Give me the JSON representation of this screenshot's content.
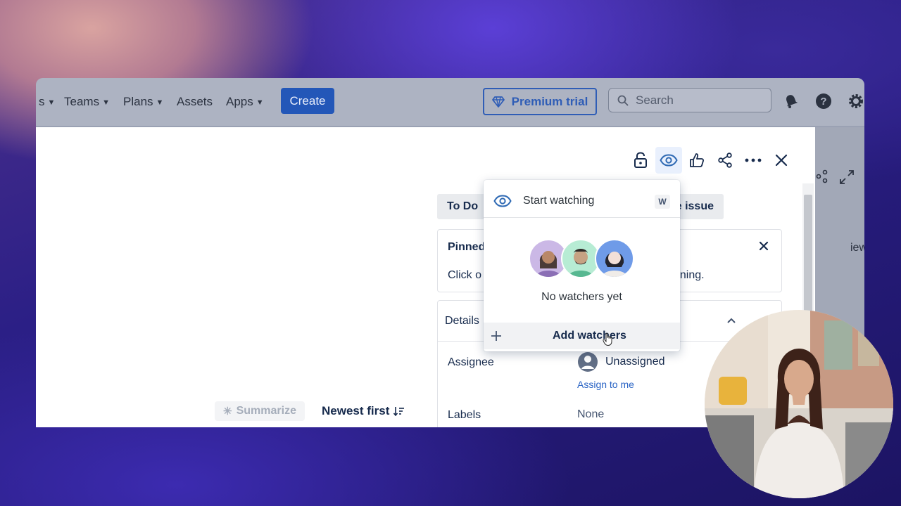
{
  "nav": {
    "cut_left": "s",
    "teams": "Teams",
    "plans": "Plans",
    "assets": "Assets",
    "apps": "Apps",
    "create": "Create",
    "premium": "Premium trial",
    "search_placeholder": "Search"
  },
  "issue": {
    "status": "To Do",
    "action_suffix": "e issue",
    "pinned_title": "Pinned",
    "pinned_text_left": "Click o",
    "pinned_text_right": "nning.",
    "details_title": "Details",
    "assignee_label": "Assignee",
    "assignee_value": "Unassigned",
    "assign_to_me": "Assign to me",
    "labels_label": "Labels",
    "labels_value": "None",
    "right_strip_text": "iew settin",
    "summarize": "Summarize",
    "sort": "Newest first"
  },
  "watch_popover": {
    "start_watching": "Start watching",
    "shortcut": "W",
    "empty_text": "No watchers yet",
    "add_watchers": "Add watchers"
  },
  "colors": {
    "primary": "#2357b8",
    "watch_icon": "#2f6ab4"
  }
}
